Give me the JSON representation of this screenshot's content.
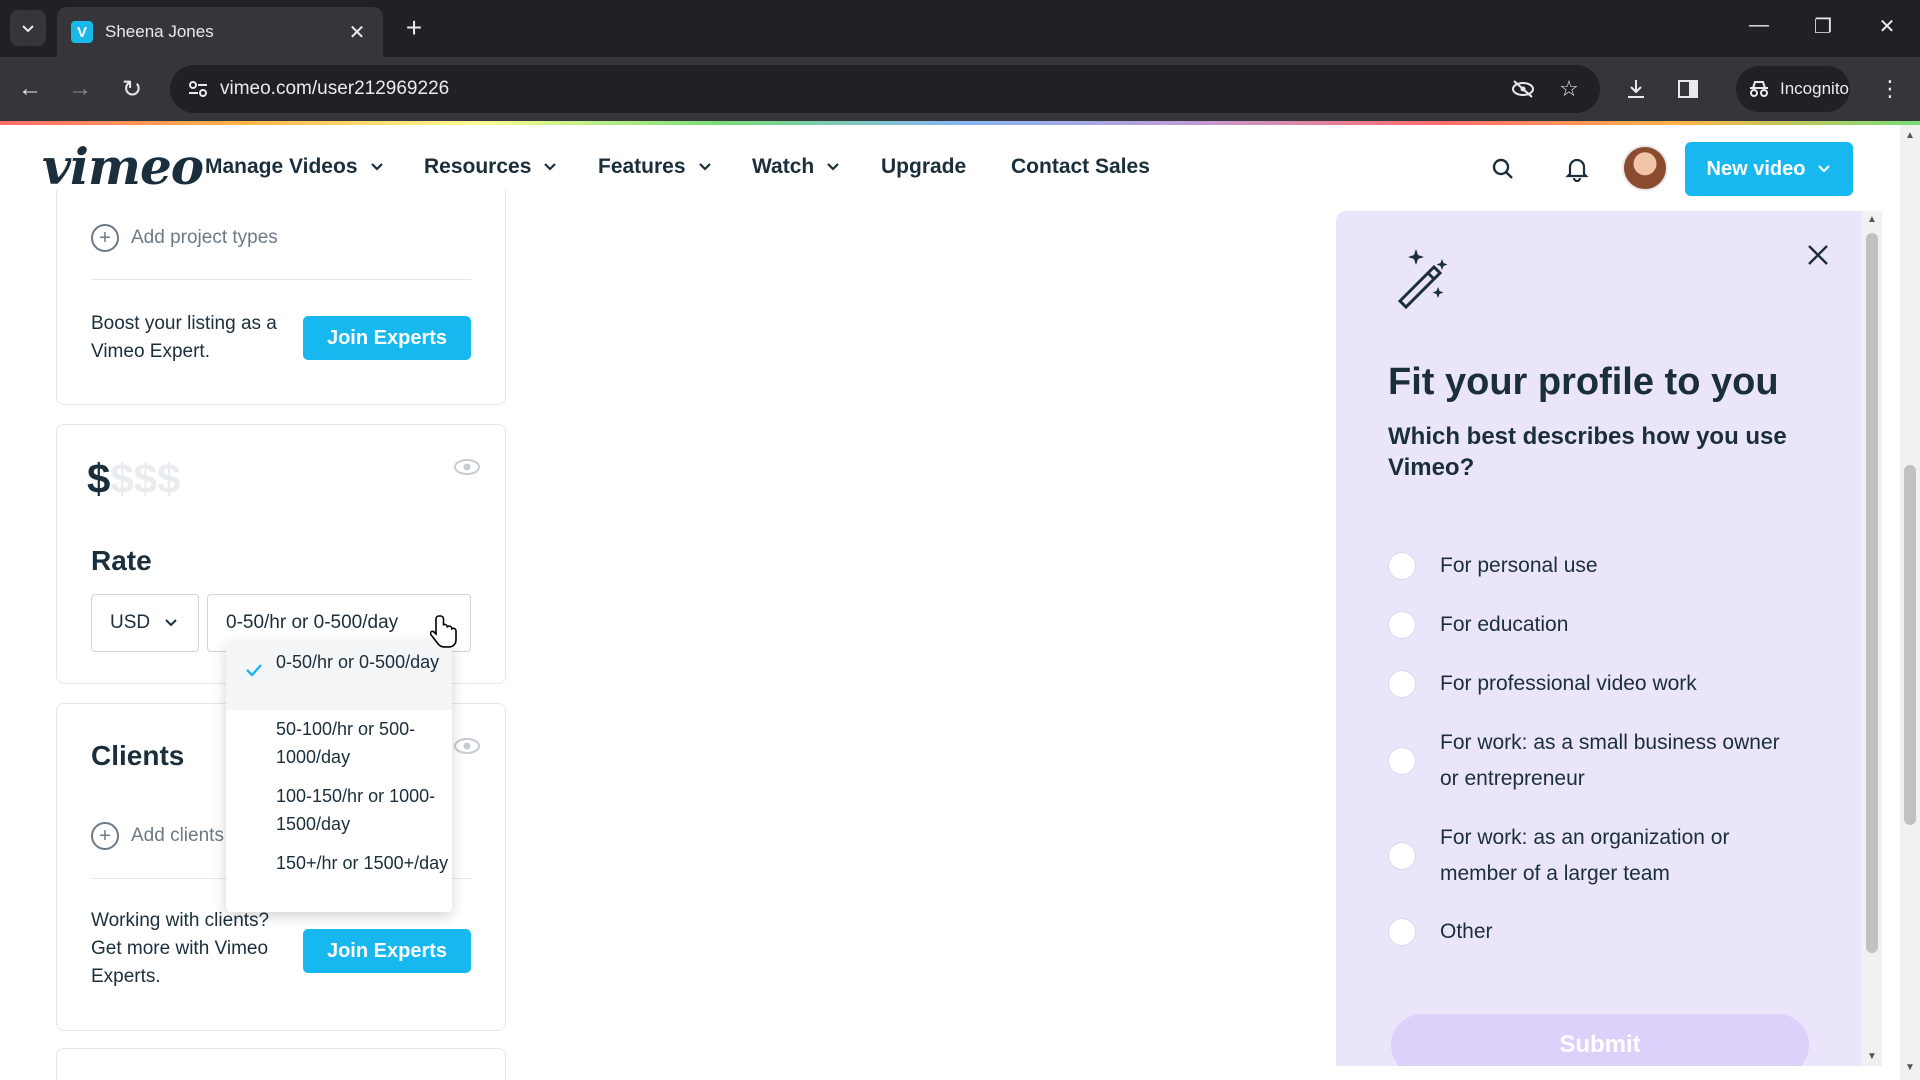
{
  "browser": {
    "tab_title": "Sheena Jones",
    "tab_favicon": "V",
    "url": "vimeo.com/user212969226",
    "incognito_label": "Incognito"
  },
  "header": {
    "logo": "vimeo",
    "nav": [
      "Manage Videos",
      "Resources",
      "Features",
      "Watch",
      "Upgrade",
      "Contact Sales"
    ],
    "new_video_label": "New video",
    "brand_color": "#17b8f0"
  },
  "profile": {
    "project_types_add": "Add project types",
    "boost_text": "Boost your listing as a Vimeo Expert.",
    "join_experts_label": "Join Experts",
    "rate_symbol": "$",
    "rate_placeholder": "$$$",
    "rate_title": "Rate",
    "currency": "USD",
    "rate_selected": "0-50/hr or 0-500/day",
    "rate_options": [
      "0-50/hr or 0-500/day",
      "50-100/hr or 500-1000/day",
      "100-150/hr or 1000-1500/day",
      "150+/hr or 1500+/day"
    ],
    "clients_title": "Clients",
    "clients_add": "Add clients",
    "clients_text": "Working with clients? Get more with Vimeo Experts.",
    "join_experts_label_2": "Join Experts"
  },
  "panel": {
    "title": "Fit your profile to you",
    "question": "Which best describes how you use Vimeo?",
    "options": [
      "For personal use",
      "For education",
      "For professional video work",
      "For work: as a small business owner or entrepreneur",
      "For work: as an organization or member of a larger team",
      "Other"
    ],
    "submit_label": "Submit",
    "background_color": "#ebe5fb"
  }
}
